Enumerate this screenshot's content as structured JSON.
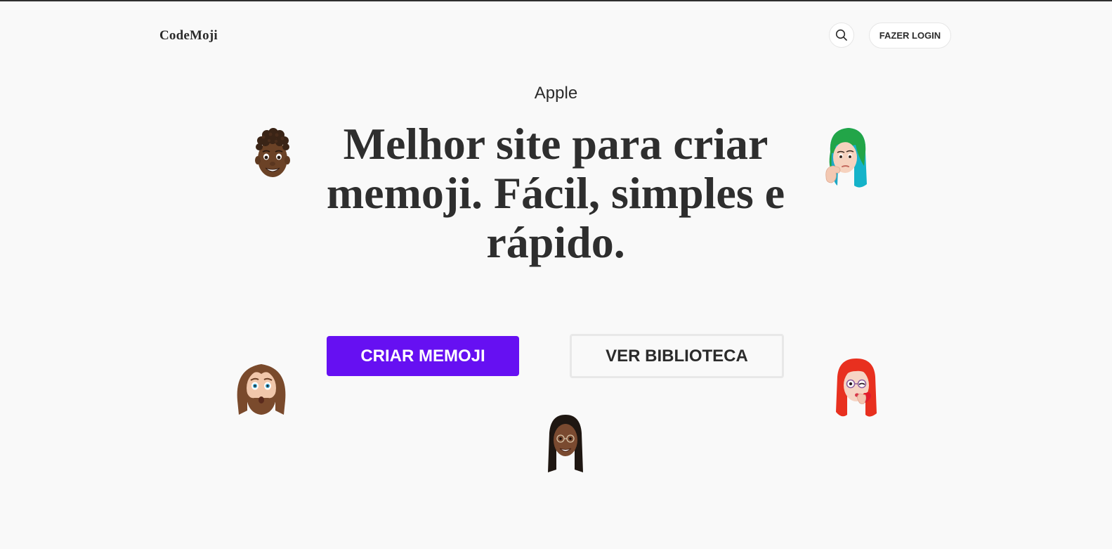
{
  "header": {
    "logo": "CodeMoji",
    "search_icon": "search-icon",
    "login_label": "FAZER LOGIN"
  },
  "hero": {
    "eyebrow": "Apple",
    "headline": "Melhor site para criar memoji. Fácil, simples e rápido.",
    "primary_button": "CRIAR MEMOJI",
    "secondary_button": "VER BIBLIOTECA"
  },
  "colors": {
    "accent": "#6610f2",
    "background": "#f9f9f9",
    "text": "#2b2b2b"
  },
  "memojis": [
    "memoji-curly-hair-boy",
    "memoji-green-hair-girl-thinking",
    "memoji-bearded-man-surprised",
    "memoji-glasses-girl",
    "memoji-red-hair-girl-kiss"
  ]
}
